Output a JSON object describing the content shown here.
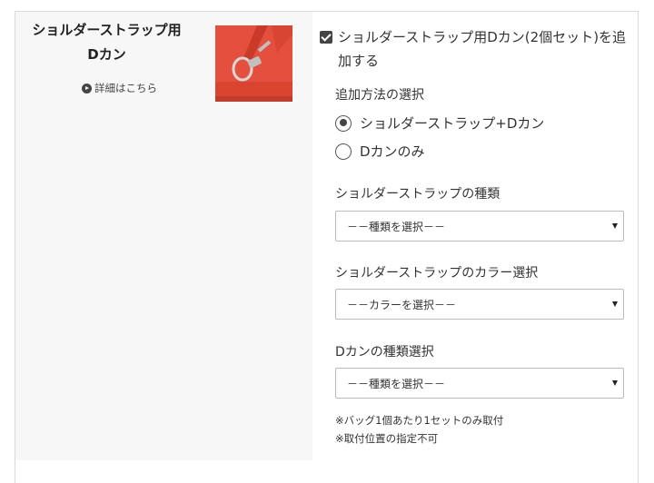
{
  "option": {
    "title_line1": "ショルダーストラップ用",
    "title_line2": "Dカン",
    "detail_link": "詳細はこちら",
    "image_alt": "red-bag-with-d-ring"
  },
  "addon": {
    "checked": true,
    "label": "ショルダーストラップ用Dカン(2個セット)を追加する"
  },
  "method": {
    "label": "追加方法の選択",
    "options": [
      {
        "label": "ショルダーストラップ+Dカン",
        "selected": true
      },
      {
        "label": "Dカンのみ",
        "selected": false
      }
    ]
  },
  "strap_type": {
    "label": "ショルダーストラップの種類",
    "value": "－－種類を選択－－"
  },
  "strap_color": {
    "label": "ショルダーストラップのカラー選択",
    "value": "－－カラーを選択－－"
  },
  "dring_type": {
    "label": "Dカンの種類選択",
    "value": "－－種類を選択－－"
  },
  "notes": [
    "※バッグ1個あたり1セットのみ取付",
    "※取付位置の指定不可"
  ],
  "colors": {
    "accent": "#e5503e",
    "panel": "#f7f7f7",
    "border": "#d9d9d9"
  }
}
